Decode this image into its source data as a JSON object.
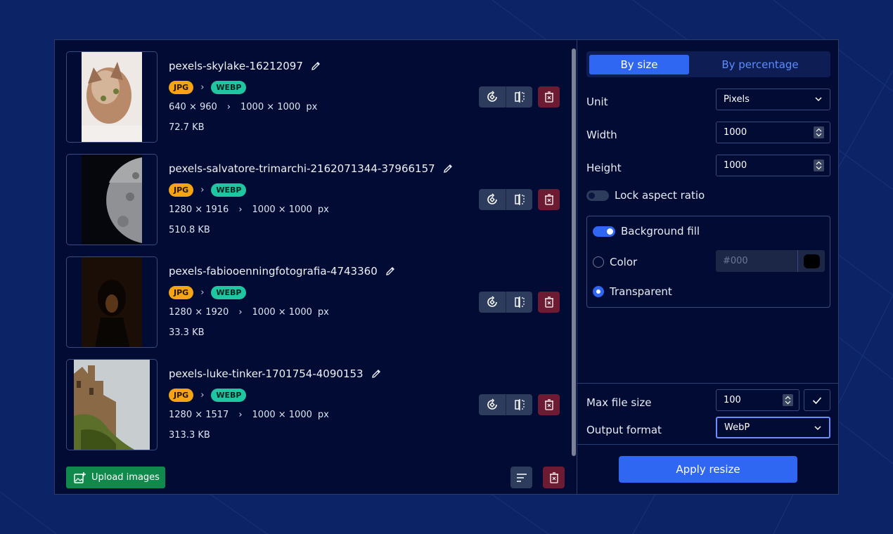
{
  "images": [
    {
      "name": "pexels-skylake-16212097",
      "from_format": "JPG",
      "to_format": "WEBP",
      "original_dims": "640 × 960",
      "target_dims": "1000 × 1000",
      "unit": "px",
      "file_size": "72.7 KB"
    },
    {
      "name": "pexels-salvatore-trimarchi-2162071344-37966157",
      "from_format": "JPG",
      "to_format": "WEBP",
      "original_dims": "1280 × 1916",
      "target_dims": "1000 × 1000",
      "unit": "px",
      "file_size": "510.8 KB"
    },
    {
      "name": "pexels-fabiooenningfotografia-4743360",
      "from_format": "JPG",
      "to_format": "WEBP",
      "original_dims": "1280 × 1920",
      "target_dims": "1000 × 1000",
      "unit": "px",
      "file_size": "33.3 KB"
    },
    {
      "name": "pexels-luke-tinker-1701754-4090153",
      "from_format": "JPG",
      "to_format": "WEBP",
      "original_dims": "1280 × 1517",
      "target_dims": "1000 × 1000",
      "unit": "px",
      "file_size": "313.3 KB"
    }
  ],
  "upload_label": "Upload images",
  "settings": {
    "tabs": {
      "active": "By size",
      "inactive": "By percentage"
    },
    "unit_label": "Unit",
    "unit_value": "Pixels",
    "width_label": "Width",
    "width_value": "1000",
    "height_label": "Height",
    "height_value": "1000",
    "lock_label": "Lock aspect ratio",
    "bg_fill_label": "Background fill",
    "color_label": "Color",
    "color_placeholder": "#000",
    "transparent_label": "Transparent",
    "max_size_label": "Max file size",
    "max_size_value": "100",
    "output_label": "Output format",
    "output_value": "WebP",
    "apply_label": "Apply resize"
  },
  "colors": {
    "accent": "#2f66f2",
    "jpg_badge": "#f5a413",
    "webp_badge": "#1fc6a2",
    "danger": "#6d1a33",
    "upload": "#0f8a4c"
  }
}
